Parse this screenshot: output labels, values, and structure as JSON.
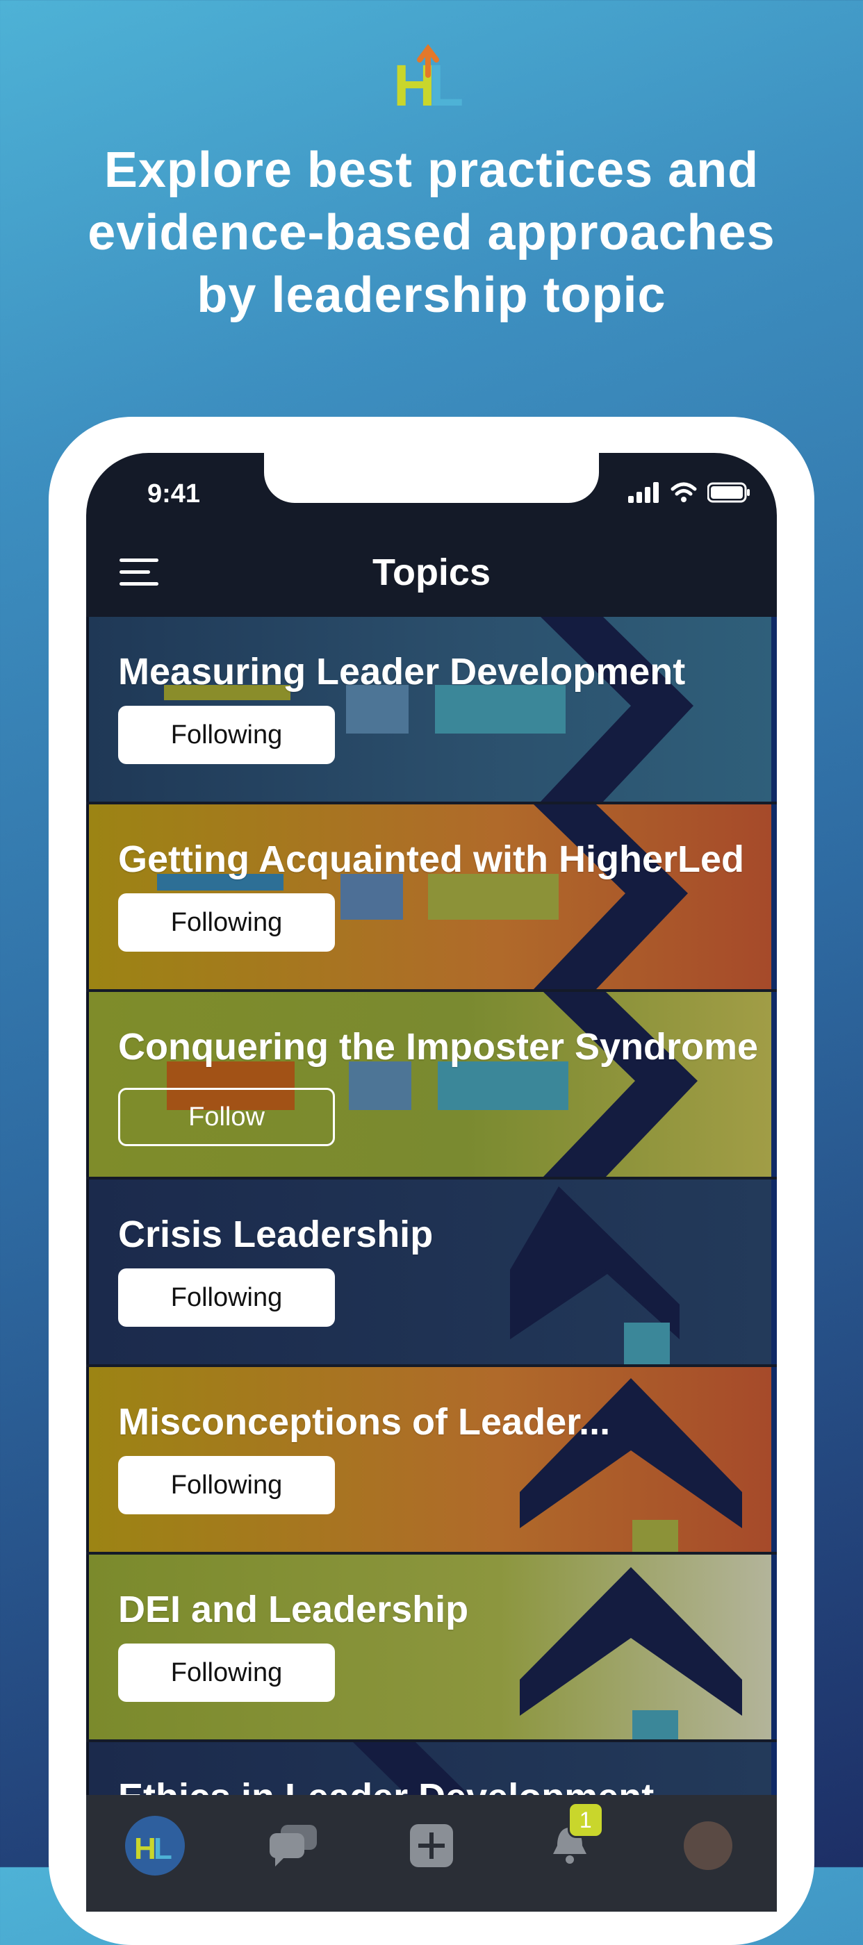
{
  "promo": {
    "logo_text": "HL",
    "headline": "Explore best practices and evidence-based approaches by leadership topic"
  },
  "status_bar": {
    "time": "9:41"
  },
  "navbar": {
    "title": "Topics"
  },
  "topics": [
    {
      "title": "Measuring Leader Development",
      "button": "Following"
    },
    {
      "title": "Getting Acquainted with HigherLed",
      "button": "Following"
    },
    {
      "title": "Conquering the Imposter Syndrome",
      "button": "Follow"
    },
    {
      "title": "Crisis Leadership",
      "button": "Following"
    },
    {
      "title": "Misconceptions of Leader...",
      "button": "Following"
    },
    {
      "title": "DEI and Leadership",
      "button": "Following"
    },
    {
      "title": "Ethics in Leader Development"
    }
  ],
  "tabbar": {
    "home_icon": "hl-logo-icon",
    "chat_icon": "chat-bubbles-icon",
    "add_icon": "plus-icon",
    "notifications_icon": "bell-icon",
    "notification_count": "1",
    "profile_icon": "avatar"
  },
  "colors": {
    "accent_green": "#c9d62c",
    "accent_blue": "#4eb2d6",
    "accent_orange": "#e3782a",
    "dark": "#141a28"
  }
}
